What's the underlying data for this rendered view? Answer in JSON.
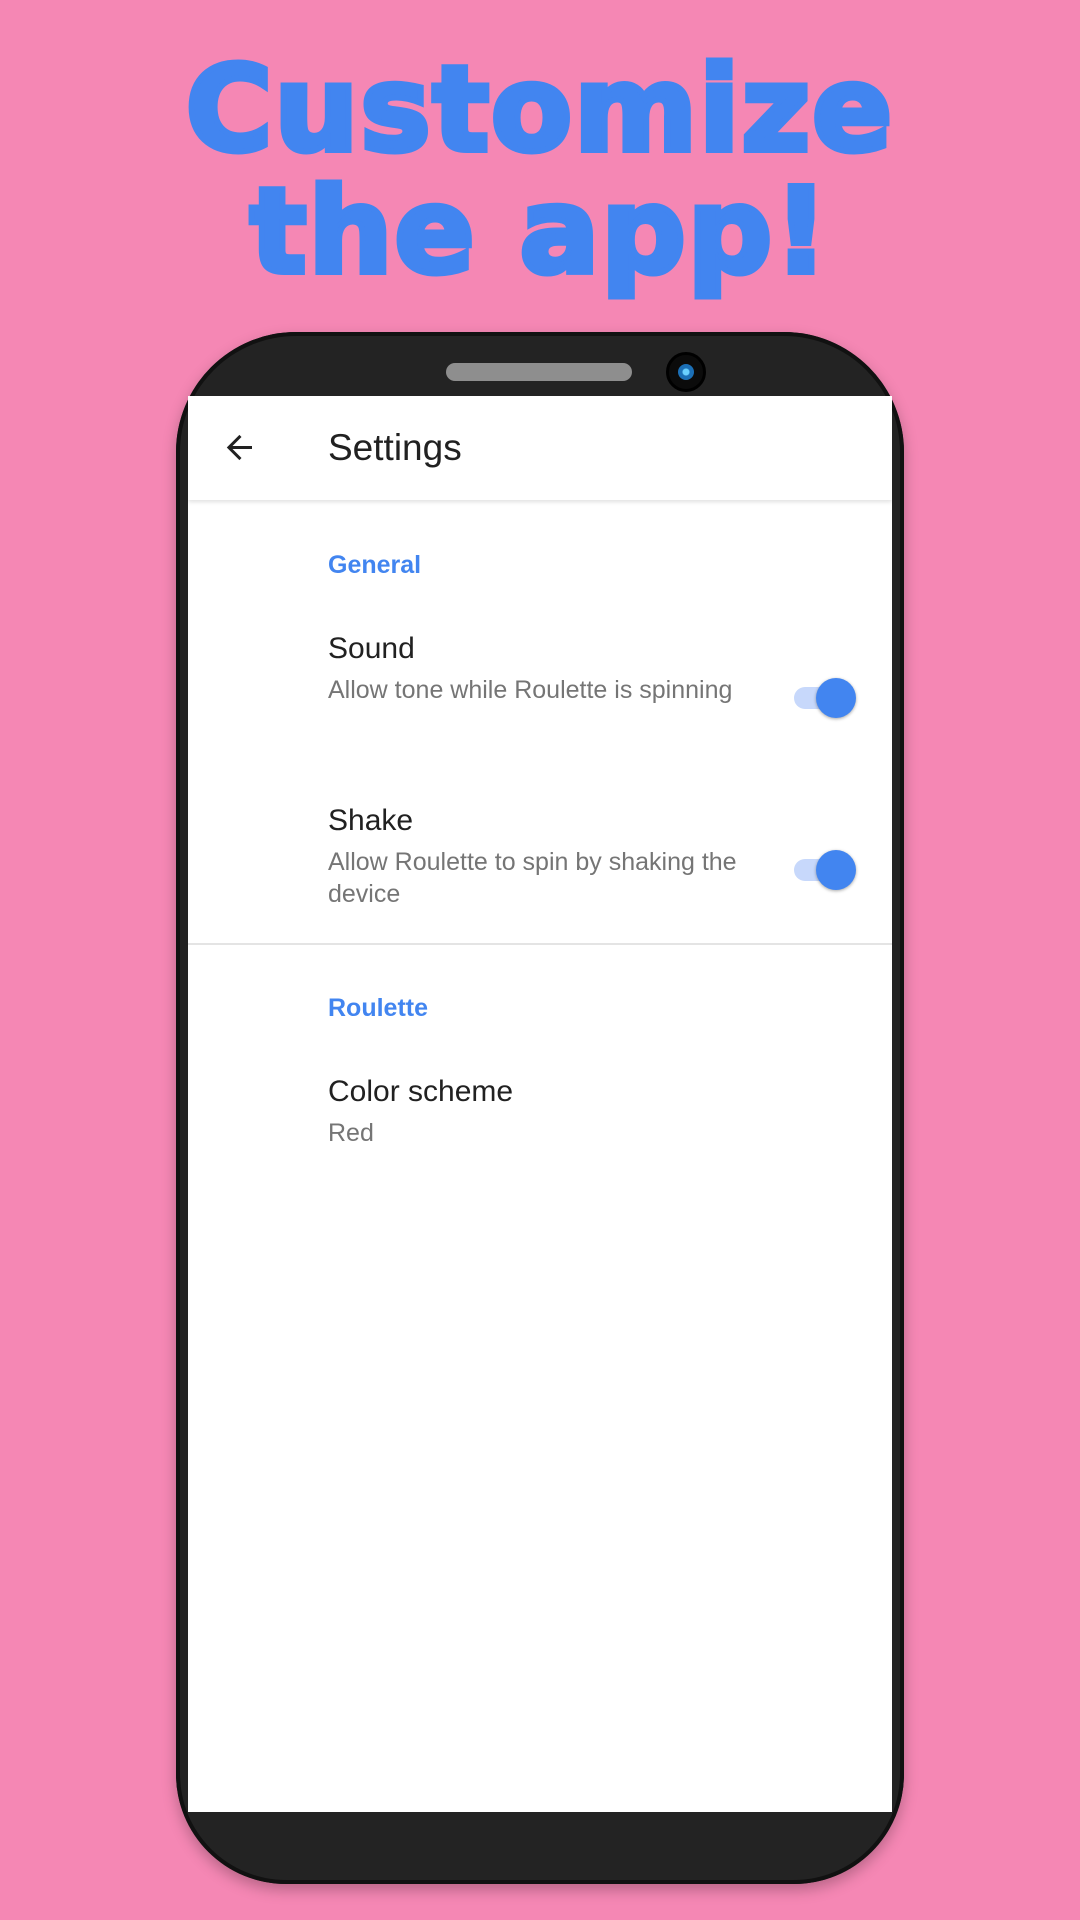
{
  "promo": {
    "line1": "Customize",
    "line2": "the app!"
  },
  "colors": {
    "background": "#f587b4",
    "accent": "#4285f0",
    "phone_body": "#232323"
  },
  "appbar": {
    "title": "Settings",
    "back_icon": "arrow-back-icon"
  },
  "sections": {
    "general": {
      "title": "General",
      "sound": {
        "title": "Sound",
        "summary": "Allow tone while Roulette is spinning",
        "enabled": true
      },
      "shake": {
        "title": "Shake",
        "summary": "Allow Roulette to spin by shaking the device",
        "enabled": true
      }
    },
    "roulette": {
      "title": "Roulette",
      "color_scheme": {
        "title": "Color scheme",
        "value": "Red"
      }
    }
  }
}
